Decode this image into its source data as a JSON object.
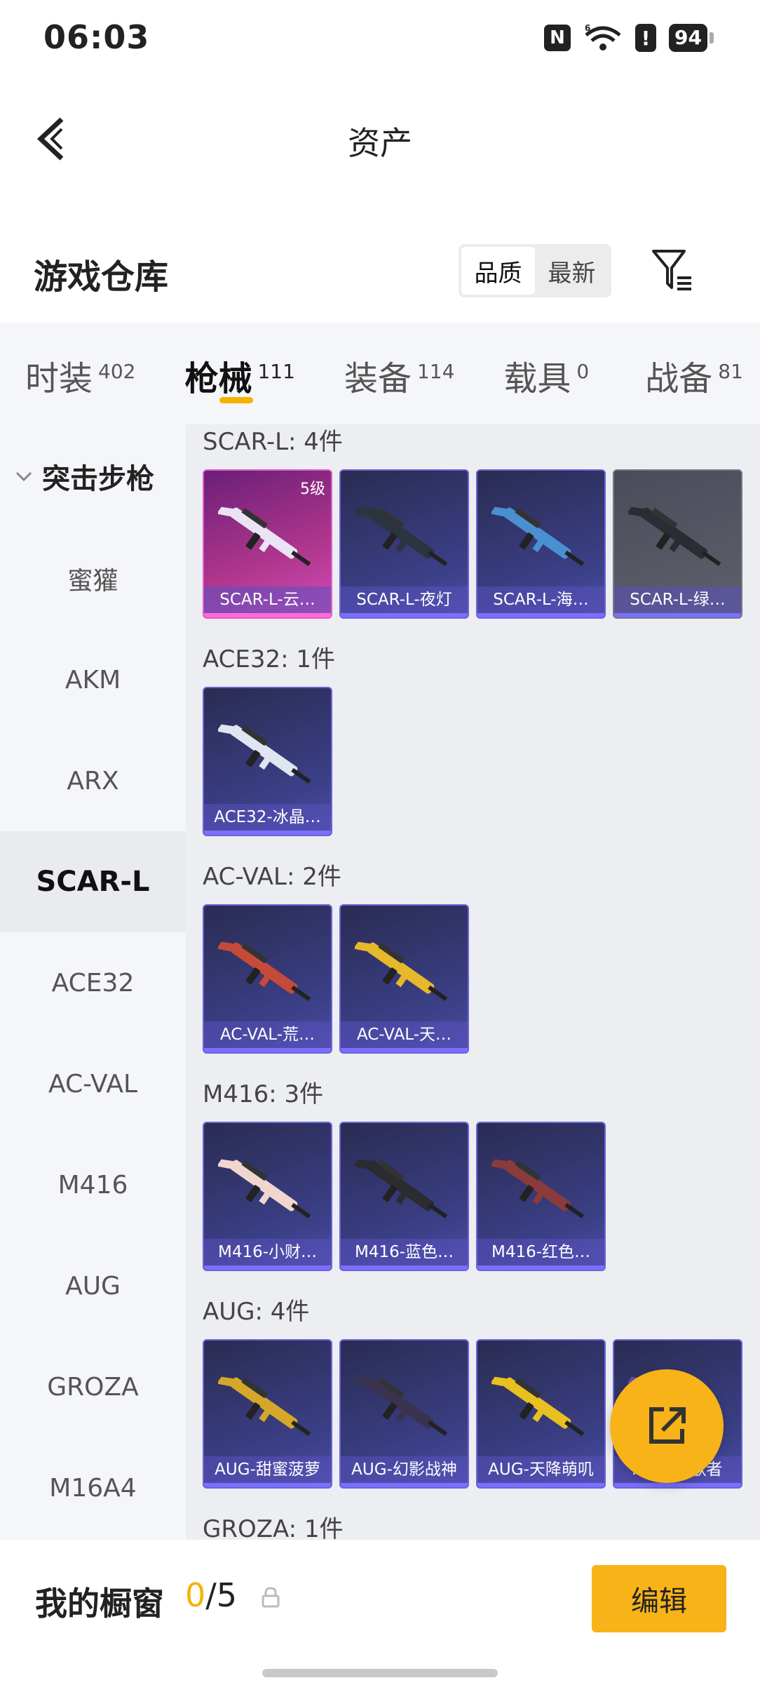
{
  "status": {
    "time": "06:03",
    "battery": "94"
  },
  "header": {
    "title": "资产"
  },
  "warehouse": {
    "title": "游戏仓库",
    "sort_options": [
      "品质",
      "最新"
    ],
    "sort_active": 0
  },
  "tabs": [
    {
      "label": "时装",
      "count": "402"
    },
    {
      "label": "枪械",
      "count": "111"
    },
    {
      "label": "装备",
      "count": "114"
    },
    {
      "label": "载具",
      "count": "0"
    },
    {
      "label": "战备",
      "count": "81"
    }
  ],
  "sidebar": {
    "group": "突击步枪",
    "items": [
      "蜜獾",
      "AKM",
      "ARX",
      "SCAR-L",
      "ACE32",
      "AC-VAL",
      "M416",
      "AUG",
      "GROZA",
      "M16A4"
    ],
    "active": "SCAR-L"
  },
  "sections": [
    {
      "header": "SCAR-L: 4件",
      "items": [
        {
          "name": "SCAR-L-云…",
          "level": "5级",
          "rarity": "pink"
        },
        {
          "name": "SCAR-L-夜灯",
          "rarity": "purple"
        },
        {
          "name": "SCAR-L-海…",
          "rarity": "purple"
        },
        {
          "name": "SCAR-L-绿…",
          "rarity": "gray"
        }
      ]
    },
    {
      "header": "ACE32: 1件",
      "items": [
        {
          "name": "ACE32-冰晶…",
          "rarity": "purple"
        }
      ]
    },
    {
      "header": "AC-VAL: 2件",
      "items": [
        {
          "name": "AC-VAL-荒…",
          "rarity": "purple"
        },
        {
          "name": "AC-VAL-天…",
          "rarity": "purple"
        }
      ]
    },
    {
      "header": "M416: 3件",
      "items": [
        {
          "name": "M416-小财…",
          "rarity": "purple"
        },
        {
          "name": "M416-蓝色…",
          "rarity": "purple"
        },
        {
          "name": "M416-红色…",
          "rarity": "purple"
        }
      ]
    },
    {
      "header": "AUG: 4件",
      "items": [
        {
          "name": "AUG-甜蜜菠萝",
          "rarity": "purple"
        },
        {
          "name": "AUG-幻影战神",
          "rarity": "purple"
        },
        {
          "name": "AUG-天降萌叽",
          "rarity": "purple"
        },
        {
          "name": "AUG-…歌者",
          "rarity": "purple"
        }
      ]
    },
    {
      "header": "GROZA: 1件",
      "items": []
    }
  ],
  "showcase": {
    "label": "我的橱窗",
    "current": "0",
    "total": "/5",
    "edit_label": "编辑"
  },
  "colors": {
    "accent": "#f8b319",
    "purple_card": "#3b3f86",
    "pink_card": "#b0368d"
  }
}
